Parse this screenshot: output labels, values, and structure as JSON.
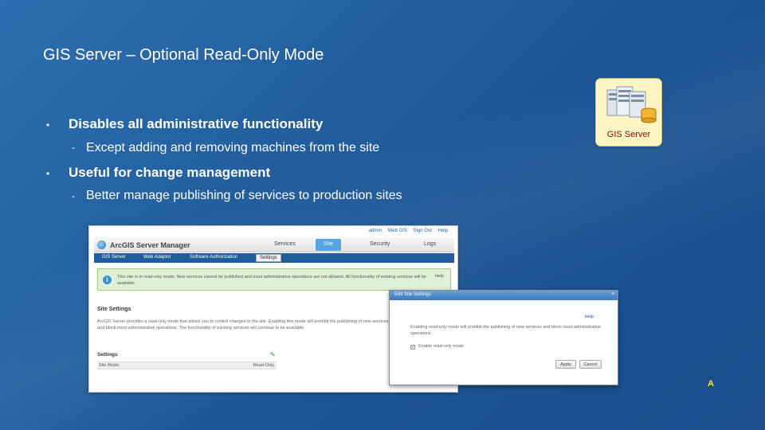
{
  "slide": {
    "title": "GIS Server – Optional Read-Only Mode",
    "bullets": [
      {
        "marker": "•",
        "text": "Disables all administrative functionality",
        "sub": {
          "marker": "-",
          "text": "Except adding and removing machines from the site"
        }
      },
      {
        "marker": "•",
        "text": "Useful for change management",
        "sub": {
          "marker": "-",
          "text": "Better manage publishing of services to production sites"
        }
      }
    ],
    "badge_label": "GIS Server",
    "corner_marker": "A"
  },
  "manager": {
    "top_links": [
      "admin",
      "Web GIS",
      "Sign Out",
      "Help"
    ],
    "app_name": "ArcGIS Server Manager",
    "main_tabs": [
      "Services",
      "Site",
      "Security",
      "Logs"
    ],
    "active_main_tab": "Site",
    "sub_tabs": [
      "GIS Server",
      "Web Adaptor",
      "Software Authorization",
      "Settings"
    ],
    "active_sub_tab": "Settings",
    "notice_text": "This site is in read-only mode. New services cannot be published and most administrative operations are not allowed. All functionality of existing services will be available.",
    "notice_help": "Help",
    "section_title": "Site Settings",
    "section_text": "ArcGIS Server provides a read-only mode that allows you to control changes to the site. Enabling this mode will prohibit the publishing of new services and block most administrative operations. The functionality of existing services will continue to be available.",
    "settings_title": "Settings",
    "settings_row_key": "Site Mode:",
    "settings_row_value": "Read-Only"
  },
  "dialog": {
    "title": "Edit Site Settings",
    "close": "×",
    "help": "Help",
    "text": "Enabling read-only mode will prohibit the publishing of new services and block most administrative operations.",
    "checkbox_label": "Enable read-only mode",
    "checkbox_checked": "✓",
    "apply_label": "Apply",
    "cancel_label": "Cancel"
  }
}
